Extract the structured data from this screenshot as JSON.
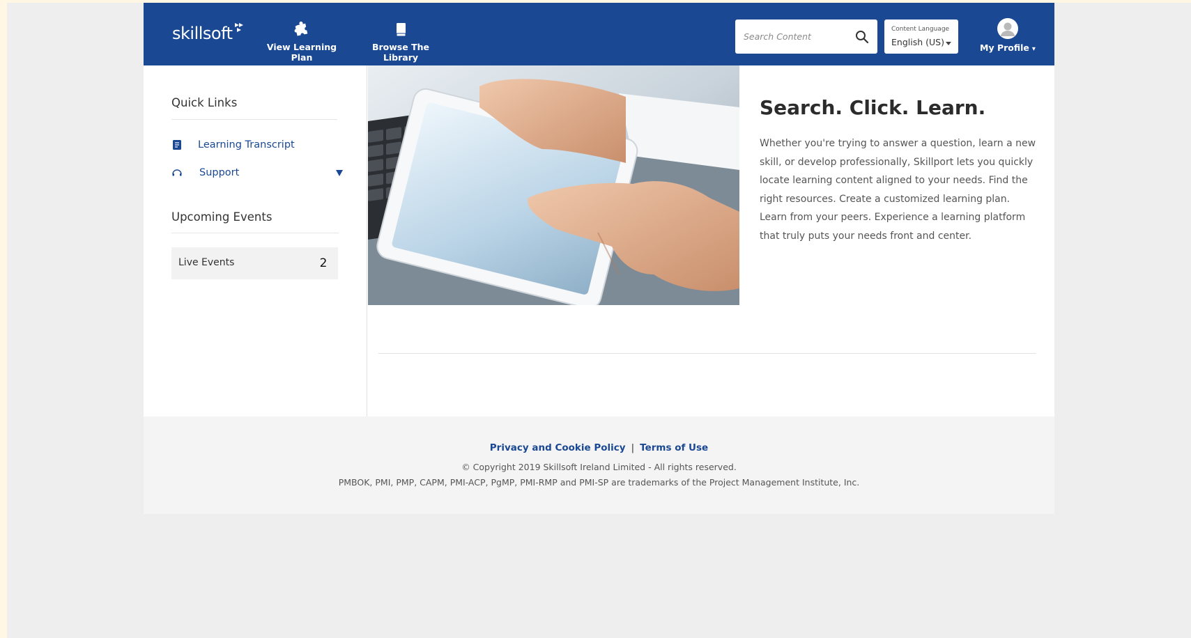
{
  "header": {
    "logo_text": "skillsoft",
    "nav": [
      {
        "label": "View Learning Plan",
        "icon": "puzzle-icon"
      },
      {
        "label": "Browse The Library",
        "icon": "book-icon"
      }
    ],
    "search": {
      "placeholder": "Search Content",
      "icon": "search-icon"
    },
    "language": {
      "caption": "Content Language",
      "value": "English (US)"
    },
    "profile": {
      "label": "My Profile",
      "caret": "▾",
      "icon": "avatar-icon"
    }
  },
  "sidebar": {
    "quick_links_title": "Quick Links",
    "links": [
      {
        "label": "Learning Transcript",
        "icon": "transcript-icon"
      },
      {
        "label": "Support",
        "icon": "headset-icon",
        "expandable": true
      }
    ],
    "upcoming_events_title": "Upcoming Events",
    "live_events": {
      "label": "Live Events",
      "count": "2"
    }
  },
  "hero": {
    "title": "Search. Click. Learn.",
    "body": "Whether you're trying to answer a question, learn a new skill, or develop professionally, Skillport lets you quickly locate learning content aligned to your needs. Find the right resources. Create a customized learning plan. Learn from your peers. Experience a learning platform that truly puts your needs front and center."
  },
  "footer": {
    "privacy": "Privacy and Cookie Policy",
    "separator": "|",
    "terms": "Terms of Use",
    "copyright": "© Copyright 2019 Skillsoft Ireland Limited - All rights reserved.",
    "trademark": "PMBOK, PMI, PMP, CAPM, PMI-ACP, PgMP, PMI-RMP and PMI-SP are trademarks of the Project Management Institute, Inc."
  },
  "colors": {
    "brand_blue": "#1a4893",
    "outer_background": "#fff7e3",
    "page_background": "#eeeeee",
    "footer_background": "#f4f4f4"
  }
}
